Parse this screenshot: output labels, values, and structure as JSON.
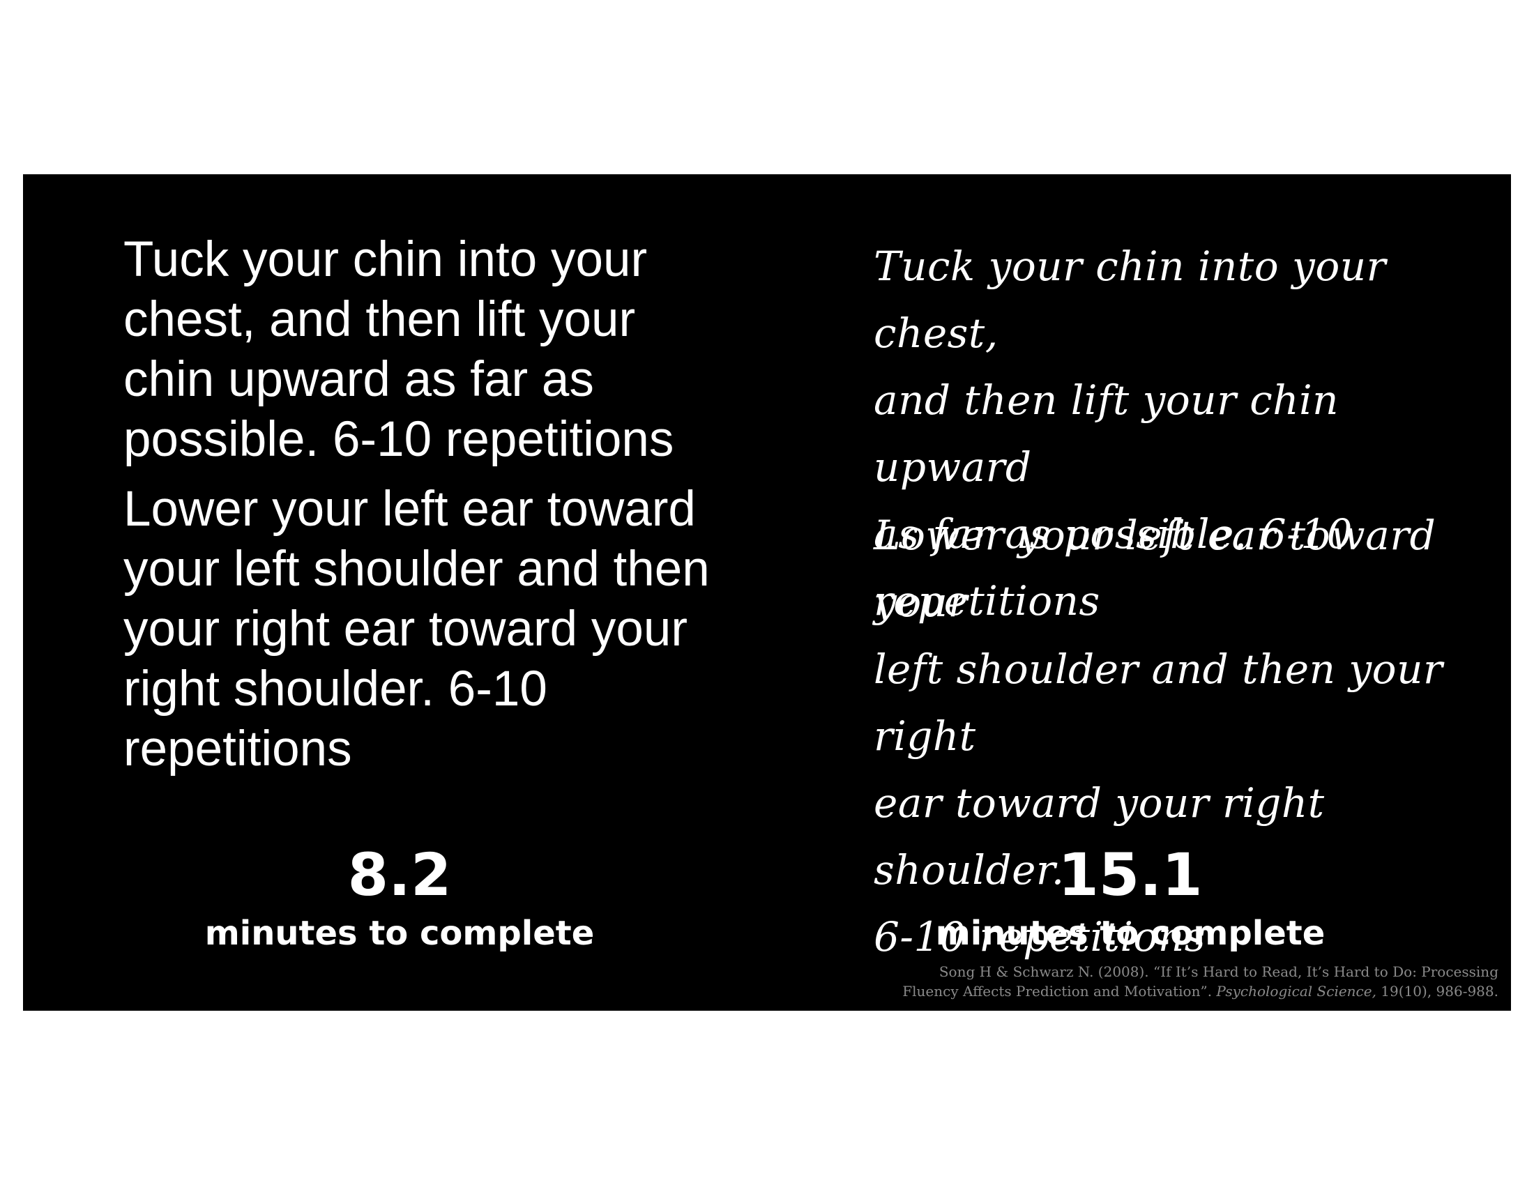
{
  "left": {
    "paragraph_1": "Tuck your chin into your\nchest, and then lift your\nchin upward as far as\npossible. 6-10 repetitions",
    "paragraph_2": "Lower your left ear toward\nyour left shoulder and then\nyour right ear toward your\nright shoulder. 6-10\nrepetitions",
    "stat_value": "8.2",
    "stat_label": "minutes to complete"
  },
  "right": {
    "paragraph_1": "Tuck your chin into your chest,\nand then lift your chin upward\nas far as possible. 6-10\nrepetitions",
    "paragraph_2": "Lower your left ear toward your\nleft shoulder and then your right\near toward your right shoulder.\n6-10 repetitions",
    "stat_value": "15.1",
    "stat_label": "minutes to complete"
  },
  "citation": {
    "line_1": "Song H & Schwarz N. (2008). “If It’s Hard to Read, It’s Hard to Do: Processing",
    "line_2_start": "Fluency Affects Prediction and Motivation”. ",
    "journal": "Psychological Science,",
    "line_2_end": " 19(10), 986-988."
  },
  "colors": {
    "background": "#000000",
    "text": "#ffffff",
    "citation": "#8a8a8a"
  }
}
